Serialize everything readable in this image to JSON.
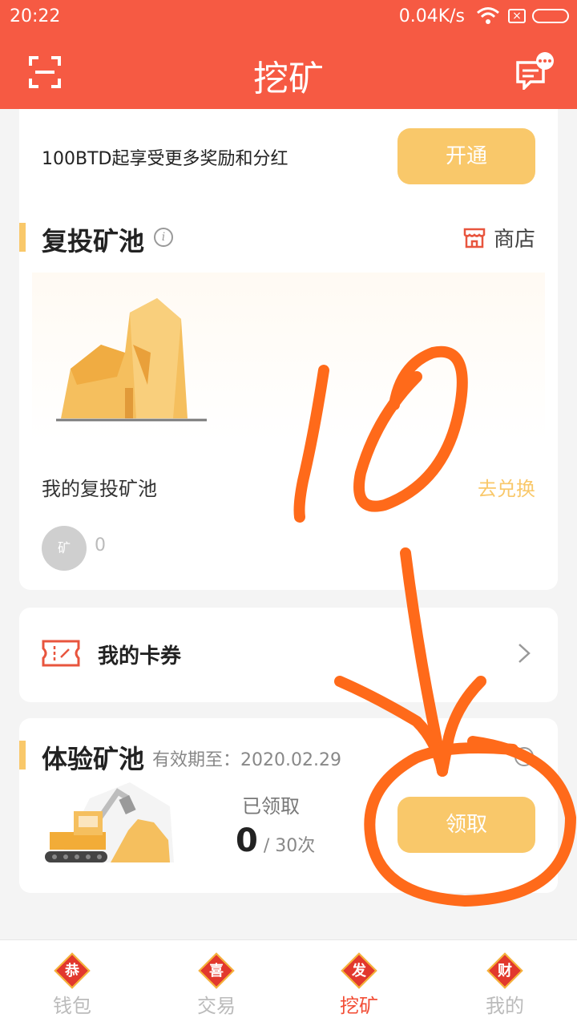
{
  "status": {
    "time": "20:22",
    "speed": "0.04K/s"
  },
  "header": {
    "title": "挖矿"
  },
  "premium_pool": {
    "description": "100BTD起享受更多奖励和分红",
    "open_label": "开通"
  },
  "reinvest_pool": {
    "title": "复投矿池",
    "shop_label": "商店",
    "my_pool_label": "我的复投矿池",
    "exchange_label": "去兑换",
    "coin_label": "矿",
    "coin_value": "0"
  },
  "coupons": {
    "label": "我的卡券"
  },
  "trial_pool": {
    "title": "体验矿池",
    "validity": "有效期至：2020.02.29",
    "claimed_label": "已领取",
    "claimed_count": "0",
    "claimed_total": " / 30次",
    "claim_label": "领取"
  },
  "tabs": [
    {
      "icon_char": "恭",
      "label": "钱包"
    },
    {
      "icon_char": "喜",
      "label": "交易"
    },
    {
      "icon_char": "发",
      "label": "挖矿"
    },
    {
      "icon_char": "财",
      "label": "我的"
    }
  ],
  "annotation": {
    "text": "10"
  },
  "colors": {
    "brand": "#f65a43",
    "accent": "#f9c86a",
    "annotation": "#ff6a1a"
  }
}
